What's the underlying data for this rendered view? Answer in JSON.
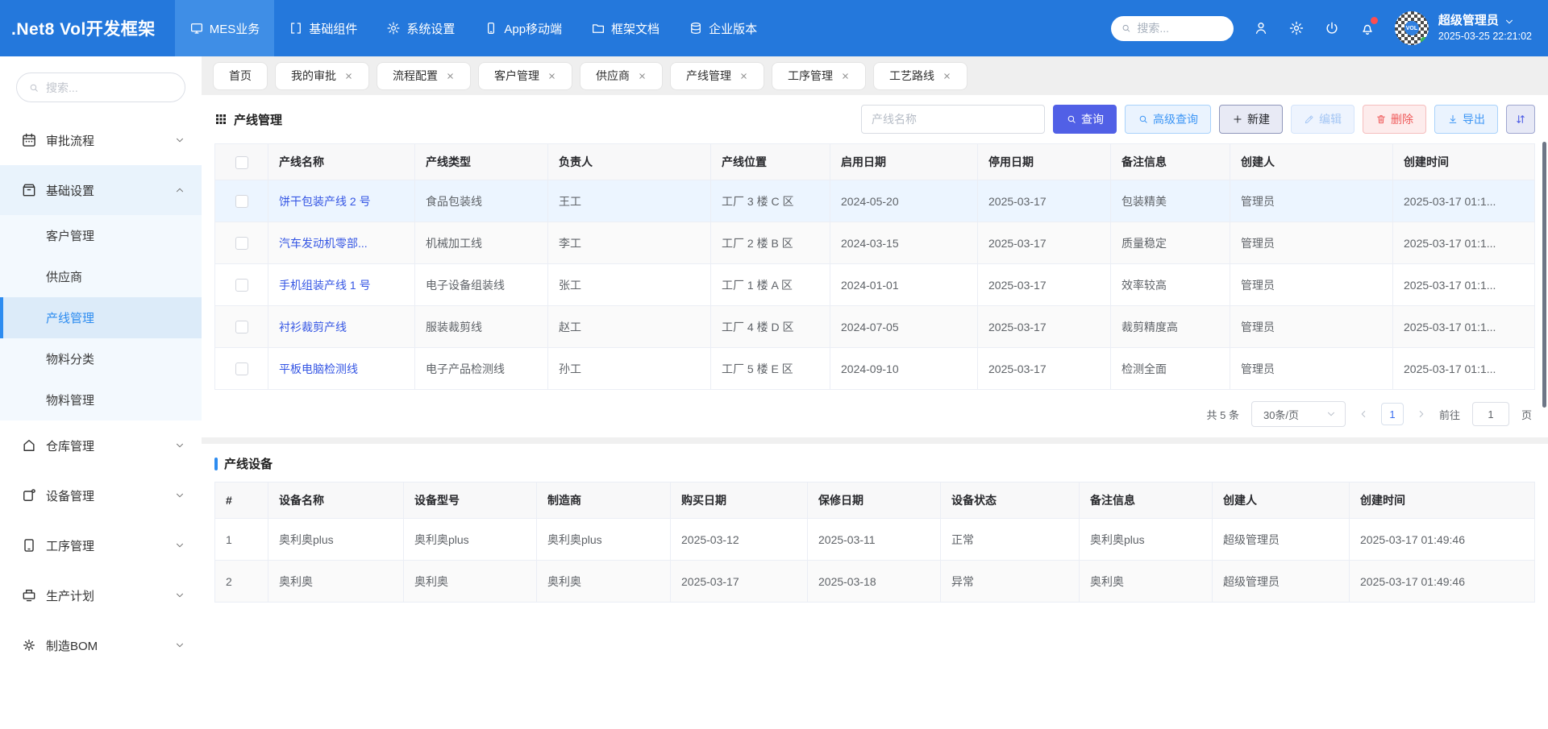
{
  "topbar": {
    "logo": ".Net8 Vol开发框架",
    "nav": [
      {
        "label": "MES业务",
        "icon": "monitor-icon",
        "active": true
      },
      {
        "label": "基础组件",
        "icon": "brackets-icon",
        "active": false
      },
      {
        "label": "系统设置",
        "icon": "gear-icon",
        "active": false
      },
      {
        "label": "App移动端",
        "icon": "phone-icon",
        "active": false
      },
      {
        "label": "框架文档",
        "icon": "folder-icon",
        "active": false
      },
      {
        "label": "企业版本",
        "icon": "database-icon",
        "active": false
      }
    ],
    "search_placeholder": "搜索...",
    "avatar_text": "VOL",
    "user_name": "超级管理员",
    "timestamp": "2025-03-25 22:21:02"
  },
  "sidebar": {
    "search_placeholder": "搜索...",
    "menu": [
      {
        "label": "审批流程",
        "icon": "calendar-icon"
      },
      {
        "label": "基础设置",
        "icon": "archive-icon",
        "expanded": true,
        "children": [
          {
            "label": "客户管理",
            "active": false
          },
          {
            "label": "供应商",
            "active": false
          },
          {
            "label": "产线管理",
            "active": true
          },
          {
            "label": "物料分类",
            "active": false
          },
          {
            "label": "物料管理",
            "active": false
          }
        ]
      },
      {
        "label": "仓库管理",
        "icon": "home-icon"
      },
      {
        "label": "设备管理",
        "icon": "device-icon"
      },
      {
        "label": "工序管理",
        "icon": "process-icon"
      },
      {
        "label": "生产计划",
        "icon": "plan-icon"
      },
      {
        "label": "制造BOM",
        "icon": "bom-icon"
      }
    ]
  },
  "tabs": [
    {
      "label": "首页",
      "closable": false
    },
    {
      "label": "我的审批",
      "closable": true
    },
    {
      "label": "流程配置",
      "closable": true
    },
    {
      "label": "客户管理",
      "closable": true
    },
    {
      "label": "供应商",
      "closable": true
    },
    {
      "label": "产线管理",
      "closable": true
    },
    {
      "label": "工序管理",
      "closable": true
    },
    {
      "label": "工艺路线",
      "closable": true
    }
  ],
  "production_line": {
    "section_title": "产线管理",
    "search_placeholder": "产线名称",
    "buttons": {
      "query": "查询",
      "advanced": "高级查询",
      "create": "新建",
      "edit": "编辑",
      "remove": "删除",
      "export": "导出"
    },
    "columns": [
      "产线名称",
      "产线类型",
      "负责人",
      "产线位置",
      "启用日期",
      "停用日期",
      "备注信息",
      "创建人",
      "创建时间"
    ],
    "rows": [
      {
        "name": "饼干包装产线 2 号",
        "type": "食品包装线",
        "manager": "王工",
        "position": "工厂 3 楼 C 区",
        "start_date": "2024-05-20",
        "stop_date": "2025-03-17",
        "remark": "包装精美",
        "creator": "管理员",
        "created_at": "2025-03-17 01:1...",
        "cls": "selected"
      },
      {
        "name": "汽车发动机零部...",
        "type": "机械加工线",
        "manager": "李工",
        "position": "工厂 2 楼 B 区",
        "start_date": "2024-03-15",
        "stop_date": "2025-03-17",
        "remark": "质量稳定",
        "creator": "管理员",
        "created_at": "2025-03-17 01:1...",
        "cls": ""
      },
      {
        "name": "手机组装产线 1 号",
        "type": "电子设备组装线",
        "manager": "张工",
        "position": "工厂 1 楼 A 区",
        "start_date": "2024-01-01",
        "stop_date": "2025-03-17",
        "remark": "效率较高",
        "creator": "管理员",
        "created_at": "2025-03-17 01:1...",
        "cls": ""
      },
      {
        "name": "衬衫裁剪产线",
        "type": "服装裁剪线",
        "manager": "赵工",
        "position": "工厂 4 楼 D 区",
        "start_date": "2024-07-05",
        "stop_date": "2025-03-17",
        "remark": "裁剪精度高",
        "creator": "管理员",
        "created_at": "2025-03-17 01:1...",
        "cls": ""
      },
      {
        "name": "平板电脑检测线",
        "type": "电子产品检测线",
        "manager": "孙工",
        "position": "工厂 5 楼 E 区",
        "start_date": "2024-09-10",
        "stop_date": "2025-03-17",
        "remark": "检测全面",
        "creator": "管理员",
        "created_at": "2025-03-17 01:1...",
        "cls": ""
      }
    ],
    "pagination": {
      "total": "共 5 条",
      "page_size": "30条/页",
      "current_page": "1",
      "goto_label": "前往",
      "goto_value": "1",
      "page_unit": "页"
    }
  },
  "line_equipment": {
    "section_title": "产线设备",
    "columns": [
      "#",
      "设备名称",
      "设备型号",
      "制造商",
      "购买日期",
      "保修日期",
      "设备状态",
      "备注信息",
      "创建人",
      "创建时间"
    ],
    "rows": [
      {
        "index": "1",
        "name": "奥利奥plus",
        "model": "奥利奥plus",
        "manufacturer": "奥利奥plus",
        "buy_date": "2025-03-12",
        "warranty_date": "2025-03-11",
        "status": "正常",
        "remark": "奥利奥plus",
        "creator": "超级管理员",
        "created_at": "2025-03-17 01:49:46"
      },
      {
        "index": "2",
        "name": "奥利奥",
        "model": "奥利奥",
        "manufacturer": "奥利奥",
        "buy_date": "2025-03-17",
        "warranty_date": "2025-03-18",
        "status": "异常",
        "remark": "奥利奥",
        "creator": "超级管理员",
        "created_at": "2025-03-17 01:49:46"
      }
    ]
  },
  "colors": {
    "topbar_bg": "#2478dc",
    "topbar_active_bg": "#3f8ee6",
    "primary_button": "#5160e6",
    "link": "#3556e4",
    "sidebar_active": "#2d8cf0",
    "selected_row_bg": "#ecf5ff",
    "danger": "#ef5a5a",
    "info_blue": "#3d96f5",
    "notification_dot": "#ff4d4f"
  }
}
